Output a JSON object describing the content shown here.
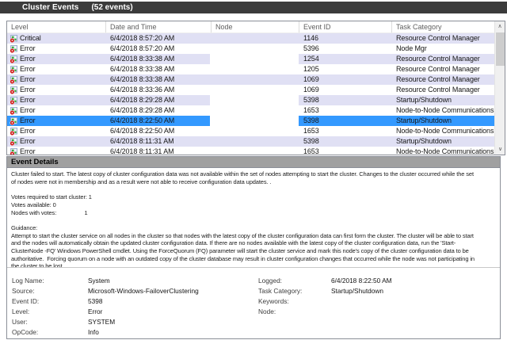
{
  "header": {
    "title": "Cluster Events",
    "count": "(52 events)"
  },
  "table": {
    "columns": [
      "Level",
      "Date and Time",
      "Node",
      "Event ID",
      "Task Category"
    ],
    "rows": [
      {
        "level": "Critical",
        "datetime": "6/4/2018 8:57:20 AM",
        "node": "",
        "event_id": "1146",
        "task_category": "Resource Control Manager",
        "selected": false,
        "node_redacted": false
      },
      {
        "level": "Error",
        "datetime": "6/4/2018 8:57:20 AM",
        "node": "",
        "event_id": "5396",
        "task_category": "Node Mgr",
        "selected": false,
        "node_redacted": false
      },
      {
        "level": "Error",
        "datetime": "6/4/2018 8:33:38 AM",
        "node": "",
        "event_id": "1254",
        "task_category": "Resource Control Manager",
        "selected": false,
        "node_redacted": true
      },
      {
        "level": "Error",
        "datetime": "6/4/2018 8:33:38 AM",
        "node": "",
        "event_id": "1205",
        "task_category": "Resource Control Manager",
        "selected": false,
        "node_redacted": false
      },
      {
        "level": "Error",
        "datetime": "6/4/2018 8:33:38 AM",
        "node": "",
        "event_id": "1069",
        "task_category": "Resource Control Manager",
        "selected": false,
        "node_redacted": false
      },
      {
        "level": "Error",
        "datetime": "6/4/2018 8:33:36 AM",
        "node": "",
        "event_id": "1069",
        "task_category": "Resource Control Manager",
        "selected": false,
        "node_redacted": false
      },
      {
        "level": "Error",
        "datetime": "6/4/2018 8:29:28 AM",
        "node": "",
        "event_id": "5398",
        "task_category": "Startup/Shutdown",
        "selected": false,
        "node_redacted": true
      },
      {
        "level": "Error",
        "datetime": "6/4/2018 8:29:28 AM",
        "node": "",
        "event_id": "1653",
        "task_category": "Node-to-Node Communications",
        "selected": false,
        "node_redacted": false
      },
      {
        "level": "Error",
        "datetime": "6/4/2018 8:22:50 AM",
        "node": "",
        "event_id": "5398",
        "task_category": "Startup/Shutdown",
        "selected": true,
        "node_redacted": true
      },
      {
        "level": "Error",
        "datetime": "6/4/2018 8:22:50 AM",
        "node": "",
        "event_id": "1653",
        "task_category": "Node-to-Node Communications",
        "selected": false,
        "node_redacted": false
      },
      {
        "level": "Error",
        "datetime": "6/4/2018 8:11:31 AM",
        "node": "",
        "event_id": "5398",
        "task_category": "Startup/Shutdown",
        "selected": false,
        "node_redacted": false
      },
      {
        "level": "Error",
        "datetime": "6/4/2018 8:11:31 AM",
        "node": "",
        "event_id": "1653",
        "task_category": "Node-to-Node Communications",
        "selected": false,
        "node_redacted": false
      }
    ]
  },
  "scrollbar": {
    "up_glyph": "∧",
    "down_glyph": "∨"
  },
  "details": {
    "title": "Event Details",
    "description_lines": [
      "Cluster failed to start. The latest copy of cluster configuration data was not available within the set of nodes attempting to start the cluster. Changes to the cluster occurred while the set",
      "of nodes were not in membership and as a result were not able to receive configuration data updates. .",
      "",
      "Votes required to start cluster: 1",
      "Votes available: 0",
      "Nodes with votes:                  1",
      "",
      "Guidance:",
      "Attempt to start the cluster service on all nodes in the cluster so that nodes with the latest copy of the cluster configuration data can first form the cluster. The cluster will be able to start",
      "and the nodes will automatically obtain the updated cluster configuration data. If there are no nodes available with the latest copy of the cluster configuration data, run the 'Start-",
      "ClusterNode -FQ' Windows PowerShell cmdlet. Using the ForceQuorum (FQ) parameter will start the cluster service and mark this node's copy of the cluster configuration data to be",
      "authoritative.  Forcing quorum on a node with an outdated copy of the cluster database may result in cluster configuration changes that occurred while the node was not participating in",
      "the cluster to be lost."
    ],
    "fields_left": [
      {
        "label": "Log Name:",
        "value": "System"
      },
      {
        "label": "Source:",
        "value": "Microsoft-Windows-FailoverClustering"
      },
      {
        "label": "Event ID:",
        "value": "5398"
      },
      {
        "label": "Level:",
        "value": "Error"
      },
      {
        "label": "User:",
        "value": "SYSTEM"
      },
      {
        "label": "OpCode:",
        "value": "Info"
      }
    ],
    "fields_right": [
      {
        "label": "Logged:",
        "value": "6/4/2018 8:22:50 AM"
      },
      {
        "label": "Task Category:",
        "value": "Startup/Shutdown"
      },
      {
        "label": "Keywords:",
        "value": ""
      },
      {
        "label": "Node:",
        "value": ""
      }
    ]
  },
  "colors": {
    "title_bar_bg": "#3b3b3b",
    "title_bar_text": "#ffffff",
    "row_alt_bg": "#e0e0f4",
    "row_selected_bg": "#3399ff",
    "details_bar_bg": "#a0a0a0",
    "panel_border": "#8b8f98",
    "error_badge": "#cf1b1b",
    "event_icon_green": "#3da53f"
  }
}
